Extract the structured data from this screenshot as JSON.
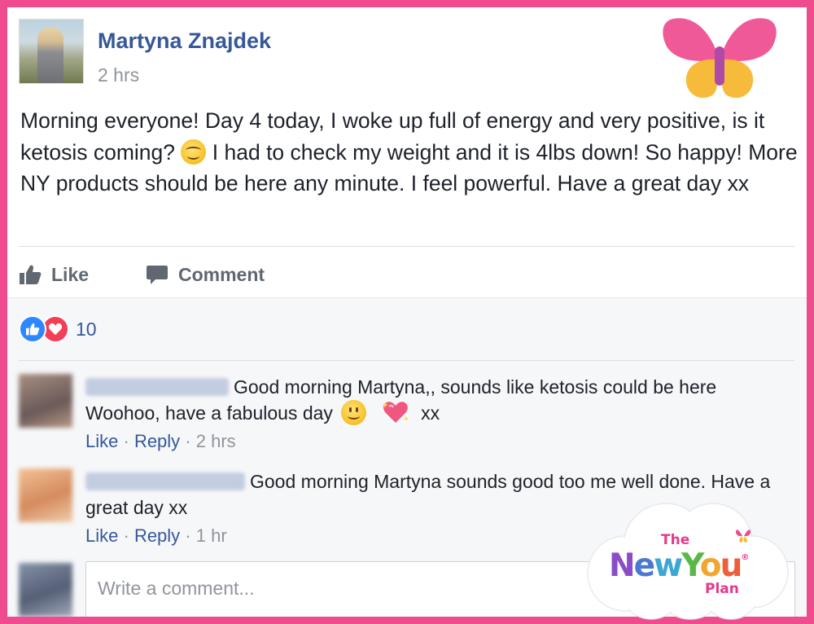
{
  "post": {
    "author": "Martyna Znajdek",
    "time": "2 hrs",
    "text_part1": "Morning everyone! Day 4 today, I woke up full of energy and very positive, is it ketosis coming?",
    "text_part2": " I had to check my weight and it is 4lbs down! So happy! More NY products should be here any minute. I feel powerful. Have a great day xx",
    "emoji": "smiling-face-with-smiling-eyes-icon"
  },
  "actions": {
    "like_label": "Like",
    "comment_label": "Comment"
  },
  "reactions": {
    "count": "10",
    "types": [
      "like",
      "love"
    ]
  },
  "comments": [
    {
      "name_hidden": true,
      "text_part1": "Good morning Martyna,, sounds like ketosis could be here Woohoo, have a fabulous day",
      "text_part2": "xx",
      "like_label": "Like",
      "reply_label": "Reply",
      "separator": "·",
      "time": "2 hrs"
    },
    {
      "name_hidden": true,
      "text": "Good morning Martyna sounds good too me well done. Have a great day xx",
      "like_label": "Like",
      "reply_label": "Reply",
      "separator": "·",
      "time": "1 hr"
    }
  ],
  "composer": {
    "placeholder": "Write a comment..."
  },
  "brand": {
    "the": "The",
    "new": "New",
    "you": "You",
    "reg": "®",
    "plan": "Plan"
  },
  "colors": {
    "frame": "#ef4b8f",
    "link": "#365899",
    "meta": "#90949c",
    "text": "#1d2129"
  }
}
